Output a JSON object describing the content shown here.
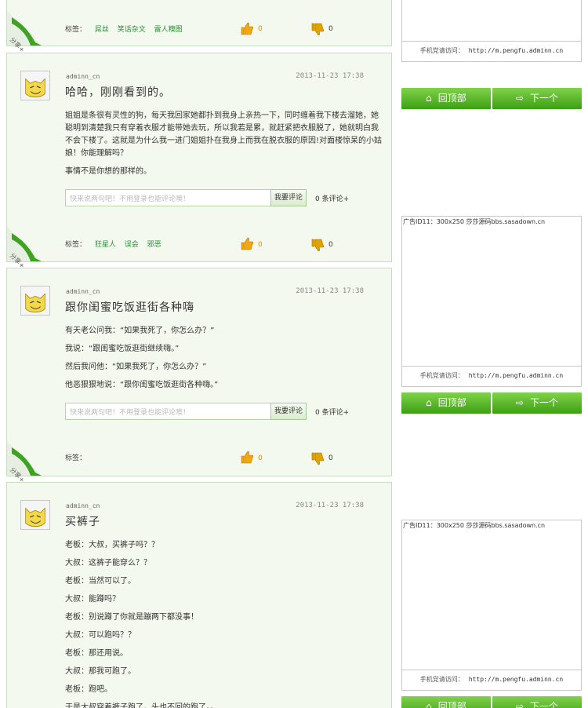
{
  "common": {
    "tags_label": "标签：",
    "comment_placeholder": "快来说两句吧！不用登录也能评论噢！",
    "comment_button": "我要评论",
    "comment_count_text": "0 条评论+",
    "share_label": "分享+",
    "up_count": "0",
    "down_count": "0"
  },
  "posts": [
    {
      "tags": [
        "屌丝",
        "笑话杂文",
        "雷人糗图"
      ]
    },
    {
      "author": "adminn_cn",
      "time": "2013-11-23 17:38",
      "title": "哈哈，刚刚看到的。",
      "paragraphs": [
        "姐姐是条很有灵性的狗，每天我回家她都扑到我身上亲热一下，同时缠着我下楼去溜她，她聪明到清楚我只有穿着衣服才能带她去玩，所以我若是累，就赶紧把衣服脱了，她就明白我不会下楼了。这就是为什么我一进门姐姐扑在我身上而我在脱衣服的原因!对面楼惊呆的小姑娘！你能理解吗？",
        "事情不是你想的那样的。"
      ],
      "tags": [
        "狂星人",
        "误会",
        "邪恶"
      ]
    },
    {
      "author": "adminn_cn",
      "time": "2013-11-23 17:38",
      "title": "跟你闺蜜吃饭逛街各种嗨",
      "lines": [
        "有天老公问我：“如果我死了，你怎么办？”",
        "我说：“跟闺蜜吃饭逛街继续嗨。”",
        "然后我问他：“如果我死了，你怎么办？”",
        "他恶狠狠地说：“跟你闺蜜吃饭逛街各种嗨。”"
      ],
      "tags": []
    },
    {
      "author": "adminn_cn",
      "time": "2013-11-23 17:38",
      "title": "买裤子",
      "lines": [
        "老板：大叔，买裤子吗？？",
        "大叔：这裤子能穿么？？",
        "老板：当然可以了。",
        "大叔：能蹲吗？",
        "老板：别说蹲了你就是蹦两下都没事！",
        "大叔：可以跑吗？？",
        "老板：那还用说。",
        "大叔：那我可跑了。",
        "老板：跑吧。",
        "于是大叔穿着裤子跑了，头也不回的跑了。。"
      ]
    }
  ],
  "sidebar": {
    "mobile_label": "手机党请访问：",
    "mobile_url": "http://m.pengfu.adminn.cn",
    "ad_caption": "广告ID11：300x250 莎莎源码bbs.sasadown.cn",
    "top_button": "回顶部",
    "next_button": "下一个"
  },
  "colors": {
    "post_bg": "#f3f9ef",
    "accent_green": "#3e9f14",
    "tag_green": "#2f8a3a"
  }
}
